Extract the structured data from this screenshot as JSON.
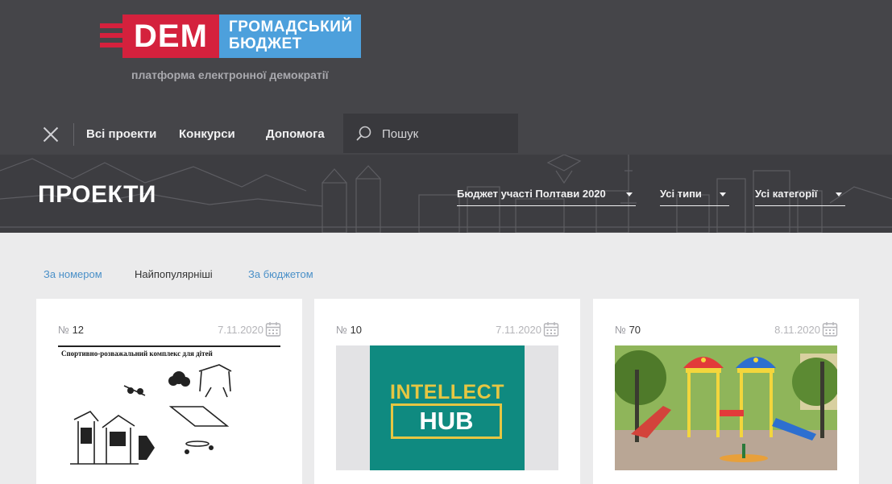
{
  "header": {
    "logo": {
      "dem": "DEM",
      "line1": "ГРОМАДСЬКИЙ",
      "line2": "БЮДЖЕТ"
    },
    "tagline": "платформа електронної демократії",
    "nav": [
      {
        "label": "Всі проекти"
      },
      {
        "label": "Конкурси"
      },
      {
        "label": "Допомога"
      }
    ],
    "search": {
      "placeholder": "Пошук",
      "value": ""
    }
  },
  "hero": {
    "title": "ПРОЕКТИ",
    "filters": [
      {
        "label": "Бюджет участі Полтави 2020"
      },
      {
        "label": "Усі типи"
      },
      {
        "label": "Усі категорії"
      }
    ]
  },
  "sort": [
    {
      "label": "За номером",
      "active": false
    },
    {
      "label": "Найпопулярніші",
      "active": true
    },
    {
      "label": "За бюджетом",
      "active": false
    }
  ],
  "cards": [
    {
      "num_prefix": "№",
      "number": "12",
      "date": "7.11.2020",
      "image_caption": "Спортивно-розважальний комплекс для дітей",
      "image": "playground-sketch"
    },
    {
      "num_prefix": "№",
      "number": "10",
      "date": "7.11.2020",
      "image_line1": "INTELLECT",
      "image_line2": "HUB",
      "image": "intellect-hub-logo"
    },
    {
      "num_prefix": "№",
      "number": "70",
      "date": "8.11.2020",
      "image": "playground-photo"
    }
  ],
  "colors": {
    "header_bg": "#454549",
    "hero_bg": "#3d3d41",
    "brand_red": "#d4213d",
    "brand_blue": "#4da0dc",
    "link_blue": "#4a90c8",
    "hub_teal": "#0f8a80",
    "hub_yellow": "#e6c642"
  }
}
